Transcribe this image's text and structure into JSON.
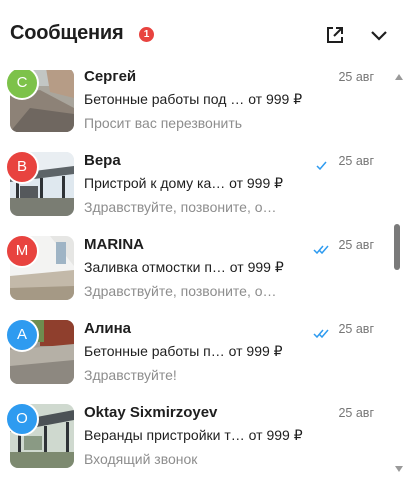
{
  "header": {
    "title": "Сообщения",
    "unread_count": "1",
    "open_icon": "external-link-icon",
    "collapse_icon": "chevron-down-icon"
  },
  "conversations": [
    {
      "avatar_letter": "С",
      "avatar_color": "#7dc24a",
      "name": "Сергей",
      "date": "25 авг",
      "read_status": "none",
      "subject": "Бетонные работы под … от 999 ₽",
      "preview": "Просит вас перезвонить",
      "thumb": "paving"
    },
    {
      "avatar_letter": "В",
      "avatar_color": "#e8433f",
      "name": "Вера",
      "date": "25 авг",
      "read_status": "sent",
      "subject": "Пристрой к дому ка… от 999 ₽",
      "preview": "Здравствуйте, позвоните, о…",
      "thumb": "canopy"
    },
    {
      "avatar_letter": "М",
      "avatar_color": "#e8433f",
      "name": "MARINA",
      "date": "25 авг",
      "read_status": "read",
      "subject": "Заливка отмостки п… от 999 ₽",
      "preview": "Здравствуйте, позвоните, о…",
      "thumb": "wall"
    },
    {
      "avatar_letter": "А",
      "avatar_color": "#2e9bf0",
      "name": "Алина",
      "date": "25 авг",
      "read_status": "read",
      "subject": "Бетонные работы п… от 999 ₽",
      "preview": "Здравствуйте!",
      "thumb": "paving2"
    },
    {
      "avatar_letter": "О",
      "avatar_color": "#2e9bf0",
      "name": "Oktay Sixmirzoyev",
      "date": "25 авг",
      "read_status": "none",
      "subject": "Веранды пристройки т… от 999 ₽",
      "preview": "Входящий звонок",
      "thumb": "canopy2"
    }
  ],
  "colors": {
    "accent": "#2e9bf0",
    "badge": "#e8433f",
    "muted": "#8d8d8d"
  }
}
